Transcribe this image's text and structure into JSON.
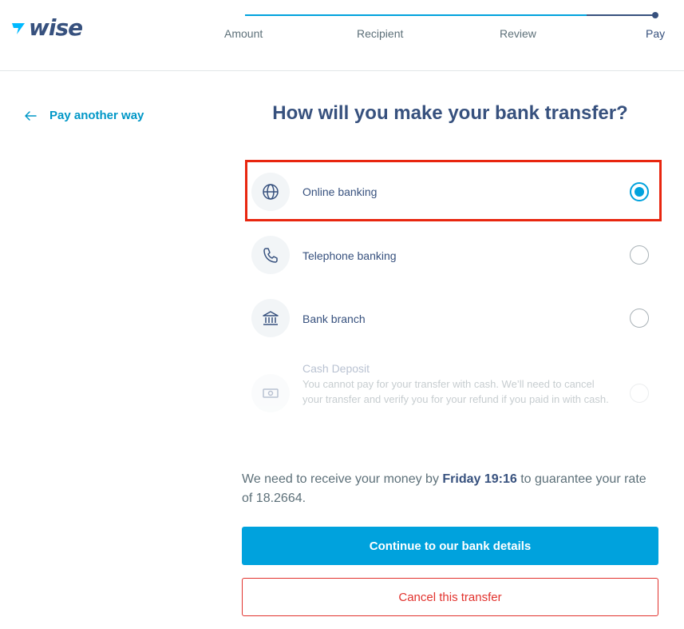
{
  "header": {
    "logo_text": "wise",
    "steps": [
      {
        "label": "Amount"
      },
      {
        "label": "Recipient"
      },
      {
        "label": "Review"
      },
      {
        "label": "Pay"
      }
    ]
  },
  "sidebar": {
    "back_label": "Pay another way"
  },
  "main": {
    "title": "How will you make your bank transfer?",
    "options": [
      {
        "label": "Online banking",
        "icon": "globe-icon",
        "selected": true
      },
      {
        "label": "Telephone banking",
        "icon": "phone-icon",
        "selected": false
      },
      {
        "label": "Bank branch",
        "icon": "bank-icon",
        "selected": false
      },
      {
        "label": "Cash Deposit",
        "icon": "cash-icon",
        "selected": false,
        "disabled": true,
        "description": "You cannot pay for your transfer with cash. We’ll need to cancel your transfer and verify you for your refund if you paid in with cash."
      }
    ],
    "info": {
      "prefix": "We need to receive your money by ",
      "deadline": "Friday 19:16",
      "suffix": " to guarantee your rate of 18.2664."
    },
    "continue_label": "Continue to our bank details",
    "cancel_label": "Cancel this transfer"
  },
  "colors": {
    "accent": "#00a2dd",
    "navy": "#37517e",
    "danger": "#e2322d",
    "highlight": "#e8260f"
  }
}
